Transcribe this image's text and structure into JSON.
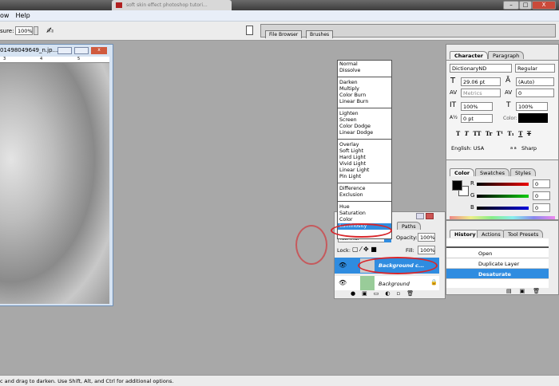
{
  "browser_tab": {
    "title": "soft skin effect photoshop tutori..."
  },
  "window_controls": {
    "minimize": "–",
    "maximize": "□",
    "close": "X"
  },
  "menu": [
    "ow",
    "Help"
  ],
  "options": {
    "exposure_label": "sure:",
    "exposure_value": "100%"
  },
  "well": {
    "tabs": [
      "File Browser",
      "Brushes"
    ]
  },
  "document": {
    "title": "01498049649_n.jp...",
    "ruler_ticks": [
      "3",
      "4",
      "5"
    ]
  },
  "blend_menu": {
    "groups": [
      [
        "Normal",
        "Dissolve"
      ],
      [
        "Darken",
        "Multiply",
        "Color Burn",
        "Linear Burn"
      ],
      [
        "Lighten",
        "Screen",
        "Color Dodge",
        "Linear Dodge"
      ],
      [
        "Overlay",
        "Soft Light",
        "Hard Light",
        "Vivid Light",
        "Linear Light",
        "Pin Light"
      ],
      [
        "Difference",
        "Exclusion"
      ],
      [
        "Hue",
        "Saturation",
        "Color",
        "Luminosity"
      ]
    ],
    "selected": "Luminosity"
  },
  "layers": {
    "tab": "Paths",
    "mode": "Normal",
    "opacity_label": "Opacity:",
    "opacity": "100%",
    "lock_label": "Lock:",
    "fill_label": "Fill:",
    "fill": "100%",
    "items": [
      {
        "name": "Background c...",
        "selected": true
      },
      {
        "name": "Background",
        "selected": false
      }
    ]
  },
  "character": {
    "tabs": [
      "Character",
      "Paragraph"
    ],
    "font": "DictionaryND",
    "style": "Regular",
    "size": "29.06 pt",
    "leading": "(Auto)",
    "kerning": "Metrics",
    "tracking": "0",
    "vscale": "100%",
    "hscale": "100%",
    "baseline": "0 pt",
    "color_label": "Color:",
    "language": "English: USA",
    "aa_label": "a a",
    "antialias": "Sharp",
    "style_buttons": [
      "T",
      "T",
      "TT",
      "Tr",
      "T¹",
      "T₁",
      "T",
      "T"
    ]
  },
  "color": {
    "tabs": [
      "Color",
      "Swatches",
      "Styles"
    ],
    "channels": [
      {
        "label": "R",
        "value": "0"
      },
      {
        "label": "G",
        "value": "0"
      },
      {
        "label": "B",
        "value": "0"
      }
    ]
  },
  "history": {
    "tabs": [
      "History",
      "Actions",
      "Tool Presets"
    ],
    "items": [
      "Open",
      "Duplicate Layer",
      "Desaturate"
    ],
    "selected": "Desaturate"
  },
  "status": {
    "text": "c and drag to darken.  Use Shift, Alt, and Ctrl for additional options."
  },
  "colors": {
    "accent": "#2f8ce0",
    "annotation": "#d8262b"
  }
}
